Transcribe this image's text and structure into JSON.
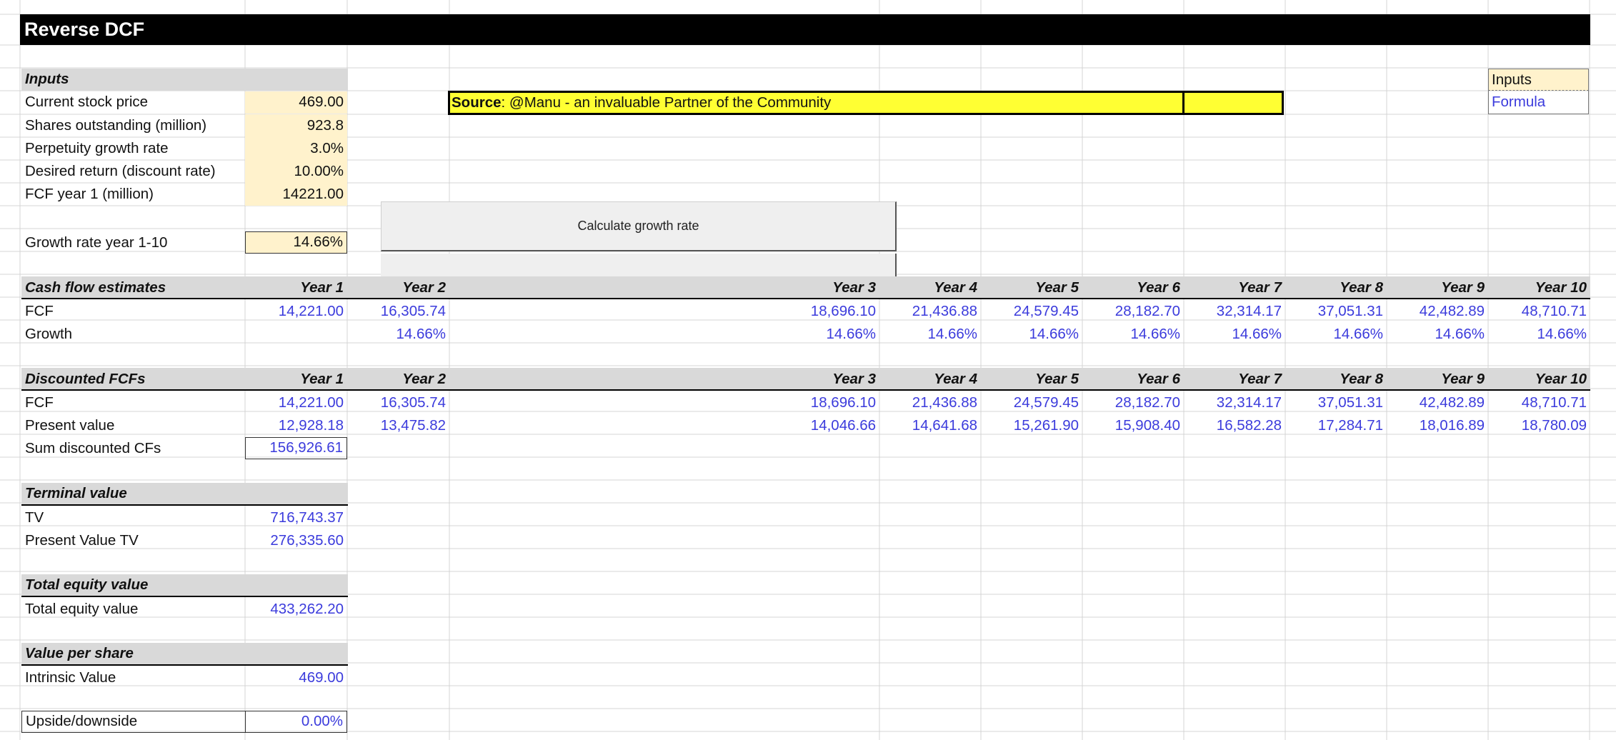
{
  "sheet": {
    "title": "Reverse DCF",
    "source_label": "Source",
    "source_text": ": @Manu - an invaluable Partner of the Community",
    "legend_inputs": "Inputs",
    "legend_formula": "Formula",
    "button_label": "Calculate growth rate"
  },
  "inputs": {
    "header": "Inputs",
    "rows": [
      {
        "label": "Current stock price",
        "value": "469.00"
      },
      {
        "label": "Shares outstanding (million)",
        "value": "923.8"
      },
      {
        "label": "Perpetuity growth rate",
        "value": "3.0%"
      },
      {
        "label": "Desired return (discount rate)",
        "value": "10.00%"
      },
      {
        "label": "FCF year 1 (million)",
        "value": "14221.00"
      }
    ],
    "growth_label": "Growth rate year 1-10",
    "growth_value": "14.66%"
  },
  "years": [
    "Year 1",
    "Year 2",
    "Year 3",
    "Year 4",
    "Year 5",
    "Year 6",
    "Year 7",
    "Year 8",
    "Year 9",
    "Year 10"
  ],
  "cash_flow": {
    "header": "Cash flow estimates",
    "fcf_label": "FCF",
    "fcf": [
      "14,221.00",
      "16,305.74",
      "18,696.10",
      "21,436.88",
      "24,579.45",
      "28,182.70",
      "32,314.17",
      "37,051.31",
      "42,482.89",
      "48,710.71"
    ],
    "growth_label": "Growth",
    "growth": [
      "",
      "14.66%",
      "14.66%",
      "14.66%",
      "14.66%",
      "14.66%",
      "14.66%",
      "14.66%",
      "14.66%",
      "14.66%"
    ]
  },
  "discounted": {
    "header": "Discounted FCFs",
    "fcf_label": "FCF",
    "fcf": [
      "14,221.00",
      "16,305.74",
      "18,696.10",
      "21,436.88",
      "24,579.45",
      "28,182.70",
      "32,314.17",
      "37,051.31",
      "42,482.89",
      "48,710.71"
    ],
    "pv_label": "Present value",
    "pv": [
      "12,928.18",
      "13,475.82",
      "14,046.66",
      "14,641.68",
      "15,261.90",
      "15,908.40",
      "16,582.28",
      "17,284.71",
      "18,016.89",
      "18,780.09"
    ],
    "sum_label": "Sum discounted CFs",
    "sum_value": "156,926.61"
  },
  "terminal": {
    "header": "Terminal value",
    "tv_label": "TV",
    "tv_value": "716,743.37",
    "pv_label": "Present Value TV",
    "pv_value": "276,335.60"
  },
  "equity": {
    "header": "Total equity value",
    "label": "Total equity value",
    "value": "433,262.20"
  },
  "per_share": {
    "header": "Value per share",
    "label": "Intrinsic Value",
    "value": "469.00"
  },
  "upside": {
    "label": "Upside/downside",
    "value": "0.00%"
  }
}
